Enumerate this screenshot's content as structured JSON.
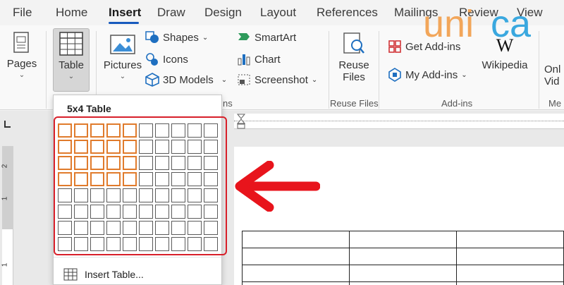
{
  "tabs": [
    {
      "label": "File",
      "active": false
    },
    {
      "label": "Home",
      "active": false
    },
    {
      "label": "Insert",
      "active": true
    },
    {
      "label": "Draw",
      "active": false
    },
    {
      "label": "Design",
      "active": false
    },
    {
      "label": "Layout",
      "active": false
    },
    {
      "label": "References",
      "active": false
    },
    {
      "label": "Mailings",
      "active": false
    },
    {
      "label": "Review",
      "active": false
    },
    {
      "label": "View",
      "active": false
    }
  ],
  "ribbon": {
    "pages": "Pages",
    "table": "Table",
    "pictures": "Pictures",
    "shapes": "Shapes",
    "icons": "Icons",
    "models3d": "3D Models",
    "smartart": "SmartArt",
    "chart": "Chart",
    "screenshot": "Screenshot",
    "reuse_files_btn": [
      "Reuse",
      "Files"
    ],
    "get_addins": "Get Add-ins",
    "my_addins": "My Add-ins",
    "wikipedia": "Wikipedia",
    "online_video": [
      "Onl",
      "Vid"
    ],
    "groups": {
      "illustrations_tail": "ns",
      "reuse_files": "Reuse Files",
      "addins": "Add-ins",
      "media_tail": "Me"
    }
  },
  "table_picker": {
    "title": "5x4 Table",
    "columns": 10,
    "rows": 8,
    "selected_columns": 5,
    "selected_rows": 4,
    "highlight_color": "#e07b2c",
    "insert_table_label": "Insert Table..."
  },
  "vertical_ruler_numbers": [
    "2",
    "1",
    "1"
  ],
  "document": {
    "table_columns": 3,
    "table_rows_visible": 4
  },
  "logo": {
    "text": "unica",
    "colors": {
      "u": "#f2a65a",
      "n": "#f2a65a",
      "i": "#f2a65a",
      "c": "#3aa8df",
      "a": "#3aa8df"
    }
  },
  "annotation_color": "#e8141c"
}
